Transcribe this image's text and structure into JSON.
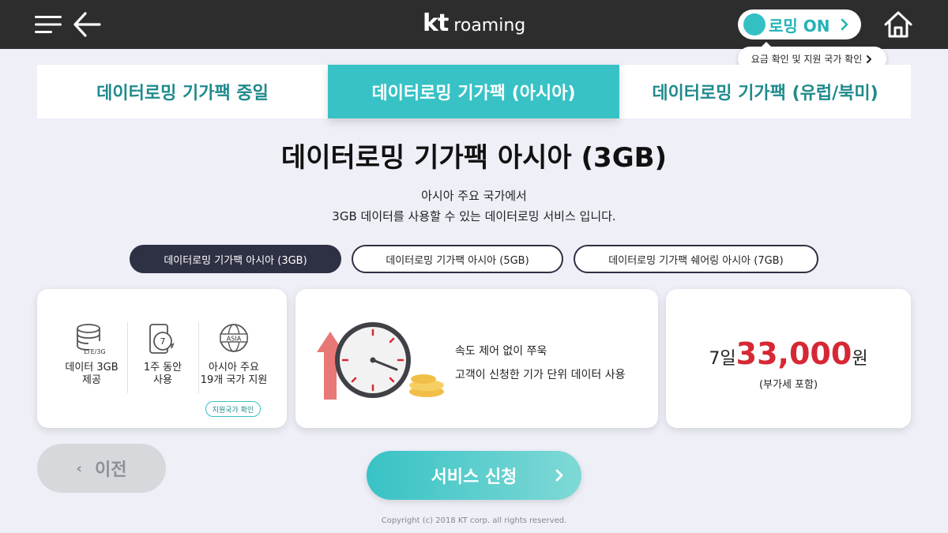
{
  "header": {
    "logo_brand": "kt",
    "logo_product": "roaming",
    "roaming_status": "로밍 ON",
    "roaming_tooltip": "요금 확인 및 지원 국가 확인",
    "icons": [
      "menu-icon",
      "back-arrow-icon",
      "chevron-right-icon",
      "home-icon"
    ]
  },
  "tabs": [
    {
      "label": "데이터로밍 기가팩 중일",
      "active": false
    },
    {
      "label": "데이터로밍 기가팩 (아시아)",
      "active": true
    },
    {
      "label": "데이터로밍 기가팩 (유럽/북미)",
      "active": false
    }
  ],
  "product": {
    "title": "데이터로밍 기가팩 아시아 (3GB)",
    "desc_line1": "아시아 주요 국가에서",
    "desc_line2": "3GB 데이터를 사용할 수 있는 데이터로밍 서비스 입니다."
  },
  "plans": [
    {
      "label": "데이터로밍 기가팩 아시아 (3GB)",
      "selected": true
    },
    {
      "label": "데이터로밍 기가팩 아시아 (5GB)",
      "selected": false
    },
    {
      "label": "데이터로밍 기가팩 쉐어링 아시아 (7GB)",
      "selected": false
    }
  ],
  "features": {
    "data_icon_text": "LTE/3G",
    "data_line1": "데이터 3GB",
    "data_line2": "제공",
    "period_icon_text": "7",
    "period_line1": "1주 동안",
    "period_line2": "사용",
    "region_icon_text": "ASIA",
    "region_line1": "아시아 주요",
    "region_line2": "19개 국가 지원",
    "support_button": "지원국가 확인"
  },
  "speed": {
    "line1": "속도 제어 없이 쭈욱",
    "line2": "고객이 신청한 기가 단위 데이터 사용"
  },
  "price": {
    "days": "7일",
    "amount": "33,000",
    "unit": "원",
    "vat": "(부가세 포함)"
  },
  "buttons": {
    "prev": "이전",
    "prev_chevron": "‹",
    "apply": "서비스 신청"
  },
  "footer": {
    "copyright": "Copyright (c) 2018 KT corp. all rights reserved."
  },
  "colors": {
    "accent": "#38c2c5",
    "dark_bar": "#2d2d2d",
    "price_red": "#d62834",
    "selected_pill": "#2e3044"
  }
}
